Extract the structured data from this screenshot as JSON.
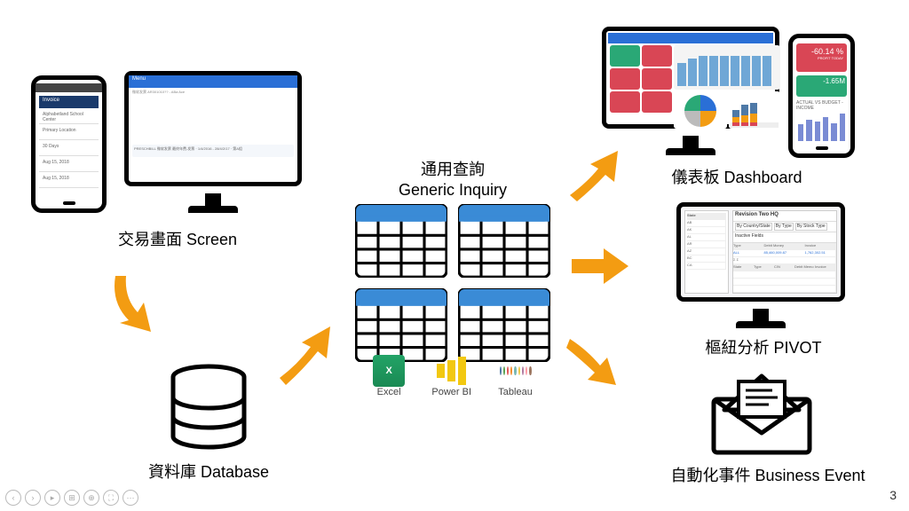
{
  "nodes": {
    "screen": {
      "label": "交易畫面 Screen"
    },
    "database": {
      "label": "資料庫 Database"
    },
    "generic_inquiry": {
      "title_zh": "通用查詢",
      "title_en": "Generic Inquiry"
    },
    "dashboard": {
      "label": "儀表板 Dashboard"
    },
    "pivot": {
      "label": "樞紐分析 PIVOT"
    },
    "business_event": {
      "label": "自動化事件 Business Event"
    }
  },
  "phone_screen": {
    "header": "Invoice",
    "rows": [
      "Alphabetland School Center",
      "Primary Location",
      "30 Days",
      "Aug 15, 2018",
      "Aug 15, 2018"
    ]
  },
  "monitor_screen": {
    "header_label": "Menu",
    "subheader": "微软发票 AR301010?? - ABa Ace",
    "row_text": "PRESCHBILL  微软发票  最终年费-发票 · 1/4/2016 - 28/4/2/17 · 第A组"
  },
  "exports": {
    "excel": "Excel",
    "powerbi": "Power BI",
    "tableau": "Tableau"
  },
  "dashboard_phone": {
    "top_value": "-60.14 %",
    "top_sub": "PROFIT TODAY",
    "mid_value": "-1.65M",
    "caption": "ACTUAL VS BUDGET - INCOME"
  },
  "pivot_panel": {
    "title": "Revision Two HQ",
    "tabs": [
      "By Country/State",
      "By Type",
      "By Stock Type"
    ],
    "section": "Inactive Fields",
    "columns": [
      "Type",
      "Debit Money",
      "Invoice"
    ],
    "totals_row": [
      "ALL",
      "85,460,009.87",
      "1,762,302.51"
    ],
    "sum_marker": "Σ Σ",
    "data_header": [
      "State",
      "Type",
      "C/N",
      "Debit Memo",
      "Invoice"
    ],
    "row_states": [
      "AB",
      "AK",
      "AL",
      "AR",
      "AZ",
      "BC",
      "CA"
    ]
  },
  "page_number": "3"
}
